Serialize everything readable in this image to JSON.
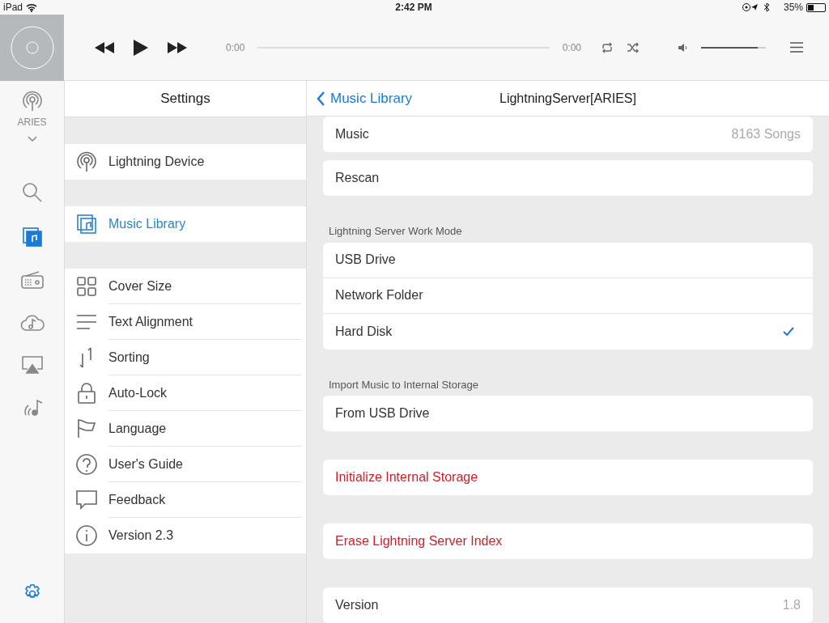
{
  "status_bar": {
    "carrier": "iPad",
    "time": "2:42 PM",
    "battery": "35%"
  },
  "player": {
    "elapsed": "0:00",
    "remaining": "0:00",
    "volume": {
      "level": 0.88
    }
  },
  "rail": {
    "device": "ARIES",
    "items": [
      {
        "kind": "search",
        "selected": false
      },
      {
        "kind": "library",
        "selected": true
      },
      {
        "kind": "radio",
        "selected": false
      },
      {
        "kind": "cloud",
        "selected": false
      },
      {
        "kind": "airplay",
        "selected": false
      },
      {
        "kind": "stream",
        "selected": false
      }
    ],
    "settings_button": {
      "selected": true
    }
  },
  "settings": {
    "title": "Settings",
    "groups": [
      [
        {
          "label": "Lightning Device",
          "kind": "device",
          "selected": false
        }
      ],
      [
        {
          "label": "Music Library",
          "kind": "library",
          "selected": true
        }
      ],
      [
        {
          "label": "Cover Size",
          "kind": "grid",
          "selected": false
        },
        {
          "label": "Text Alignment",
          "kind": "lines",
          "selected": false
        },
        {
          "label": "Sorting",
          "kind": "sort",
          "selected": false
        },
        {
          "label": "Auto-Lock",
          "kind": "lock",
          "selected": false
        },
        {
          "label": "Language",
          "kind": "flag",
          "selected": false
        },
        {
          "label": "User's Guide",
          "kind": "help",
          "selected": false
        },
        {
          "label": "Feedback",
          "kind": "chat",
          "selected": false
        },
        {
          "label": "Version 2.3",
          "kind": "info",
          "selected": false
        }
      ]
    ]
  },
  "detail": {
    "back": "Music Library",
    "title": "LightningServer[ARIES]",
    "sections": [
      {
        "rows": [
          {
            "label": "Music",
            "value": "8163 Songs",
            "kind": "normal"
          }
        ]
      },
      {
        "rows": [
          {
            "label": "Rescan",
            "kind": "normal"
          }
        ]
      },
      {
        "header": "Lightning Server Work Mode",
        "rows": [
          {
            "label": "USB Drive",
            "kind": "normal",
            "checked": false
          },
          {
            "label": "Network Folder",
            "kind": "normal",
            "checked": false
          },
          {
            "label": "Hard Disk",
            "kind": "normal",
            "checked": true
          }
        ]
      },
      {
        "header": "Import Music to Internal Storage",
        "rows": [
          {
            "label": "From USB Drive",
            "kind": "normal"
          }
        ]
      },
      {
        "rows": [
          {
            "label": "Initialize Internal Storage",
            "kind": "destructive"
          }
        ]
      },
      {
        "rows": [
          {
            "label": "Erase Lightning Server Index",
            "kind": "destructive"
          }
        ]
      },
      {
        "rows": [
          {
            "label": "Version",
            "value": "1.8",
            "kind": "normal"
          }
        ]
      }
    ]
  }
}
